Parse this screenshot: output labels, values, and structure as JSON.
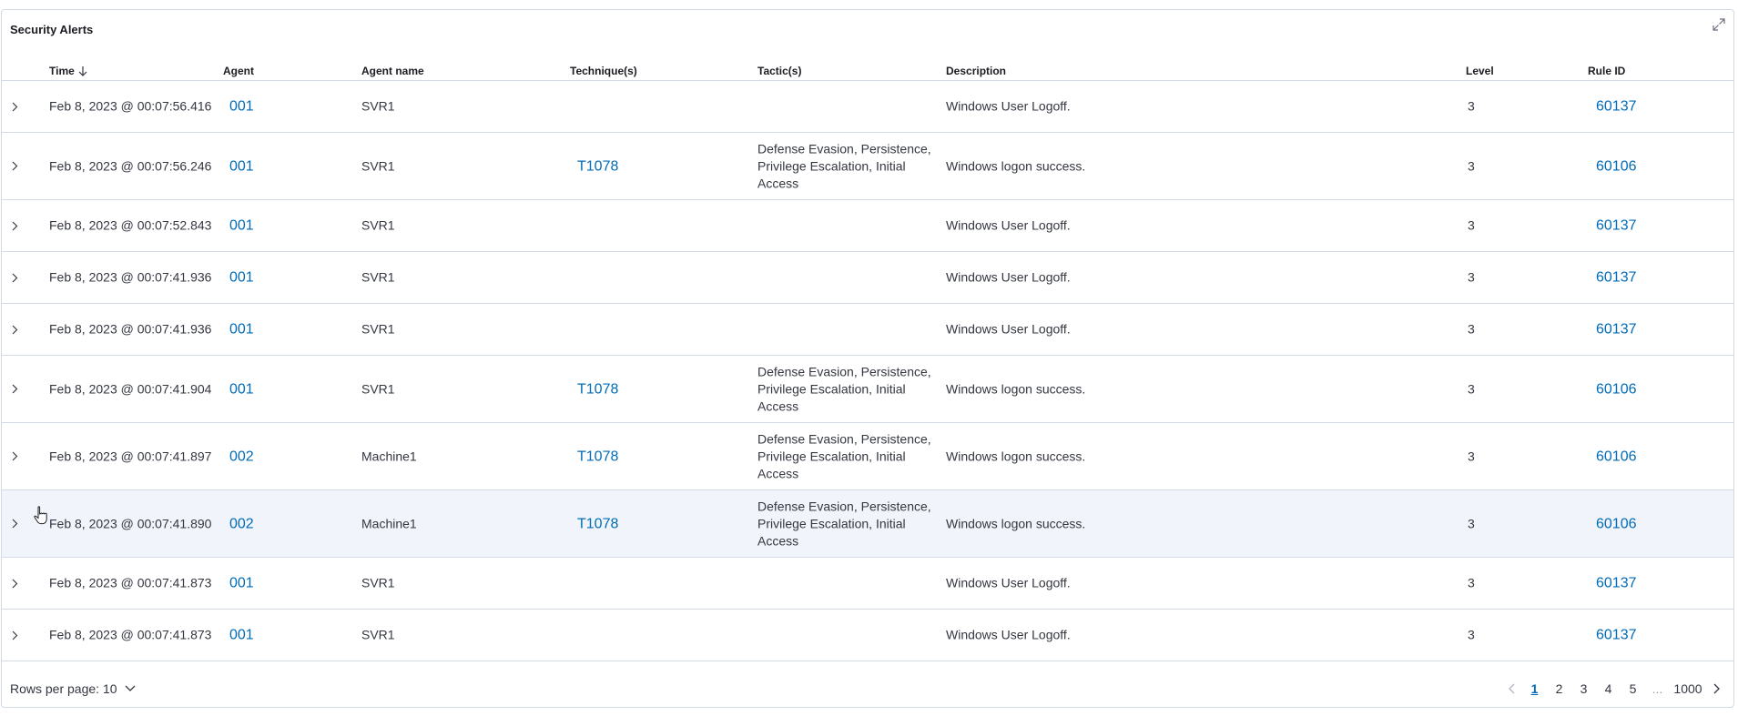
{
  "panel": {
    "title": "Security Alerts",
    "expand_icon": "expand-icon"
  },
  "columns": {
    "time": "Time",
    "agent": "Agent",
    "agent_name": "Agent name",
    "techniques": "Technique(s)",
    "tactics": "Tactic(s)",
    "description": "Description",
    "level": "Level",
    "rule_id": "Rule ID"
  },
  "sort_icon": "arrow-down-icon",
  "rows": [
    {
      "time": "Feb 8, 2023 @ 00:07:56.416",
      "agent": "001",
      "agent_name": "SVR1",
      "technique": "",
      "tactic": "",
      "description": "Windows User Logoff.",
      "level": "3",
      "rule_id": "60137"
    },
    {
      "time": "Feb 8, 2023 @ 00:07:56.246",
      "agent": "001",
      "agent_name": "SVR1",
      "technique": "T1078",
      "tactic": "Defense Evasion, Persistence, Privilege Escalation, Initial Access",
      "description": "Windows logon success.",
      "level": "3",
      "rule_id": "60106"
    },
    {
      "time": "Feb 8, 2023 @ 00:07:52.843",
      "agent": "001",
      "agent_name": "SVR1",
      "technique": "",
      "tactic": "",
      "description": "Windows User Logoff.",
      "level": "3",
      "rule_id": "60137"
    },
    {
      "time": "Feb 8, 2023 @ 00:07:41.936",
      "agent": "001",
      "agent_name": "SVR1",
      "technique": "",
      "tactic": "",
      "description": "Windows User Logoff.",
      "level": "3",
      "rule_id": "60137"
    },
    {
      "time": "Feb 8, 2023 @ 00:07:41.936",
      "agent": "001",
      "agent_name": "SVR1",
      "technique": "",
      "tactic": "",
      "description": "Windows User Logoff.",
      "level": "3",
      "rule_id": "60137"
    },
    {
      "time": "Feb 8, 2023 @ 00:07:41.904",
      "agent": "001",
      "agent_name": "SVR1",
      "technique": "T1078",
      "tactic": "Defense Evasion, Persistence, Privilege Escalation, Initial Access",
      "description": "Windows logon success.",
      "level": "3",
      "rule_id": "60106"
    },
    {
      "time": "Feb 8, 2023 @ 00:07:41.897",
      "agent": "002",
      "agent_name": "Machine1",
      "technique": "T1078",
      "tactic": "Defense Evasion, Persistence, Privilege Escalation, Initial Access",
      "description": "Windows logon success.",
      "level": "3",
      "rule_id": "60106"
    },
    {
      "time": "Feb 8, 2023 @ 00:07:41.890",
      "agent": "002",
      "agent_name": "Machine1",
      "technique": "T1078",
      "tactic": "Defense Evasion, Persistence, Privilege Escalation, Initial Access",
      "description": "Windows logon success.",
      "level": "3",
      "rule_id": "60106"
    },
    {
      "time": "Feb 8, 2023 @ 00:07:41.873",
      "agent": "001",
      "agent_name": "SVR1",
      "technique": "",
      "tactic": "",
      "description": "Windows User Logoff.",
      "level": "3",
      "rule_id": "60137"
    },
    {
      "time": "Feb 8, 2023 @ 00:07:41.873",
      "agent": "001",
      "agent_name": "SVR1",
      "technique": "",
      "tactic": "",
      "description": "Windows User Logoff.",
      "level": "3",
      "rule_id": "60137"
    }
  ],
  "highlighted_row": 7,
  "footer": {
    "rows_per_page": "Rows per page: 10",
    "pages": [
      "1",
      "2",
      "3",
      "4",
      "5"
    ],
    "ellipsis": "...",
    "last_page": "1000",
    "current_page": "1"
  },
  "colors": {
    "link": "#006bb8",
    "border": "#d3dae6",
    "highlight_row": "#f1f4fa",
    "text": "#343741"
  }
}
